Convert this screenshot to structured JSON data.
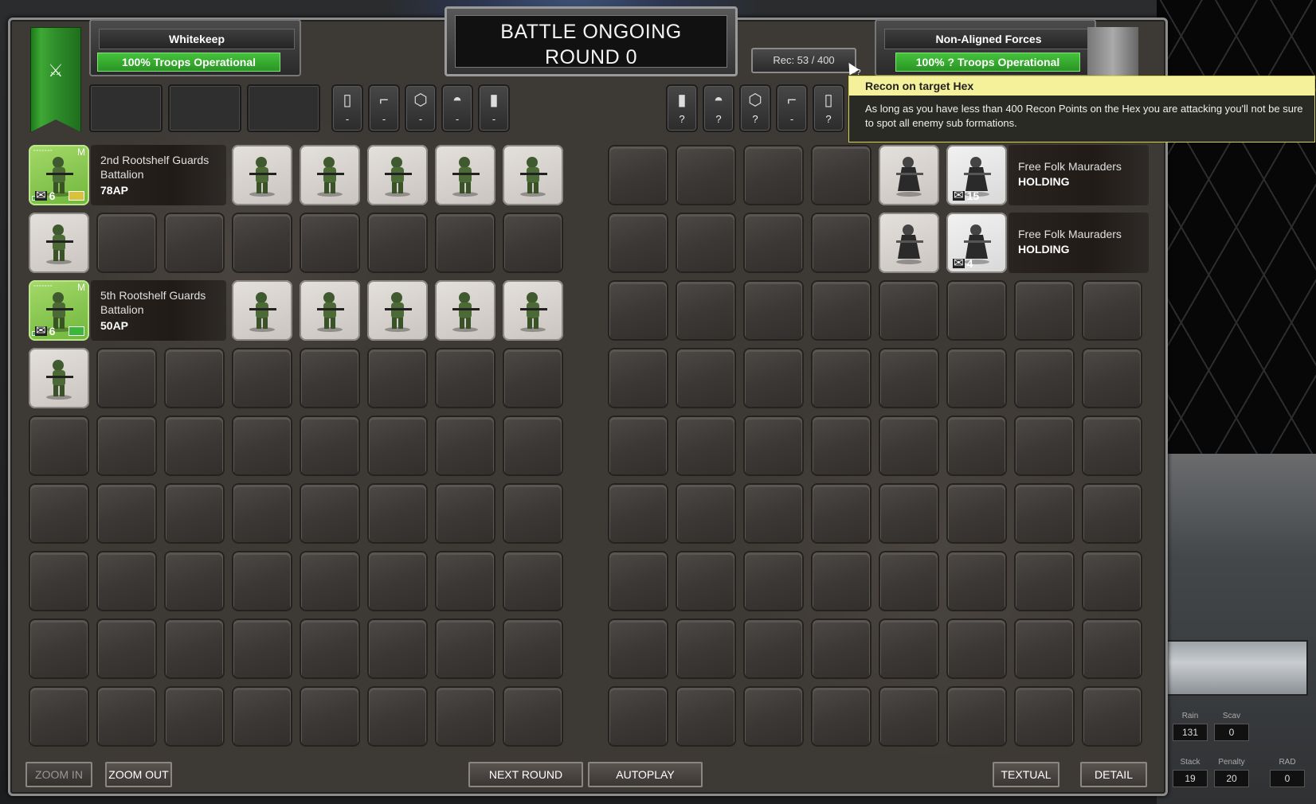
{
  "header": {
    "left_faction": "Whitekeep",
    "left_status": "100% Troops Operational",
    "right_faction": "Non-Aligned Forces",
    "right_status": "100% ? Troops Operational",
    "battle_title_line1": "BATTLE ONGOING",
    "battle_title_line2": "ROUND 0",
    "recon": "Rec: 53 / 400"
  },
  "left_resources": [
    {
      "icon": "cards-icon",
      "value": "-"
    },
    {
      "icon": "gun-icon",
      "value": "-"
    },
    {
      "icon": "hex-icon",
      "value": "-"
    },
    {
      "icon": "helmet-icon",
      "value": "-"
    },
    {
      "icon": "barrel-icon",
      "value": "-"
    }
  ],
  "right_resources": [
    {
      "icon": "barrel-icon",
      "value": "?"
    },
    {
      "icon": "helmet-icon",
      "value": "?"
    },
    {
      "icon": "hex-icon",
      "value": "?"
    },
    {
      "icon": "gun-icon",
      "value": "-"
    },
    {
      "icon": "cards-icon",
      "value": "?"
    }
  ],
  "tooltip": {
    "title": "Recon on target Hex",
    "body": "As long as you have less than 400 Recon Points on the Hex you are attacking you'll not be sure to spot all enemy sub formations."
  },
  "left_formations": [
    {
      "name": "2nd Rootshelf Guards Battalion",
      "ap": "78AP",
      "count": "6",
      "tag": "M",
      "bar": "yellow"
    },
    {
      "name": "5th Rootshelf Guards Battalion",
      "ap": "50AP",
      "count": "6",
      "tag": "M",
      "bar": "green"
    }
  ],
  "right_formations": [
    {
      "name": "Free Folk Mauraders",
      "status": "HOLDING",
      "count": "15"
    },
    {
      "name": "Free Folk Mauraders",
      "status": "HOLDING",
      "count": "4"
    }
  ],
  "buttons": {
    "zoom_in": "ZOOM IN",
    "zoom_out": "ZOOM OUT",
    "next_round": "NEXT ROUND",
    "autoplay": "AUTOPLAY",
    "textual": "TEXTUAL",
    "detail": "DETAIL"
  },
  "side_stats": {
    "rain_label": "Rain",
    "rain": "131",
    "scav_label": "Scav",
    "scav": "0",
    "stack_label": "Stack",
    "stack": "19",
    "penalty_label": "Penalty",
    "penalty": "20",
    "rad_label": "RAD",
    "rad": "0"
  }
}
